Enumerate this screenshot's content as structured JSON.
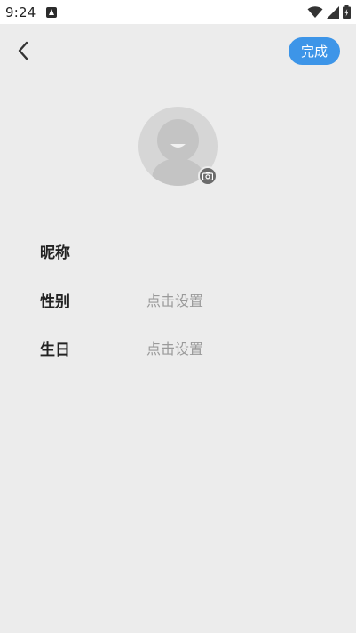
{
  "status_bar": {
    "time": "9:24",
    "app_icon": "a-icon",
    "icons": [
      "wifi-icon",
      "signal-icon",
      "battery-icon"
    ]
  },
  "header": {
    "back_icon": "chevron-left-icon",
    "done_label": "完成"
  },
  "avatar": {
    "icon": "default-avatar",
    "badge_icon": "camera-icon"
  },
  "form": {
    "nickname": {
      "label": "昵称",
      "value": ""
    },
    "gender": {
      "label": "性别",
      "value": "点击设置"
    },
    "birthday": {
      "label": "生日",
      "value": "点击设置"
    }
  },
  "colors": {
    "background": "#ececec",
    "accent": "#3d95e8",
    "placeholder": "#9a9a9a",
    "label": "#222222"
  }
}
